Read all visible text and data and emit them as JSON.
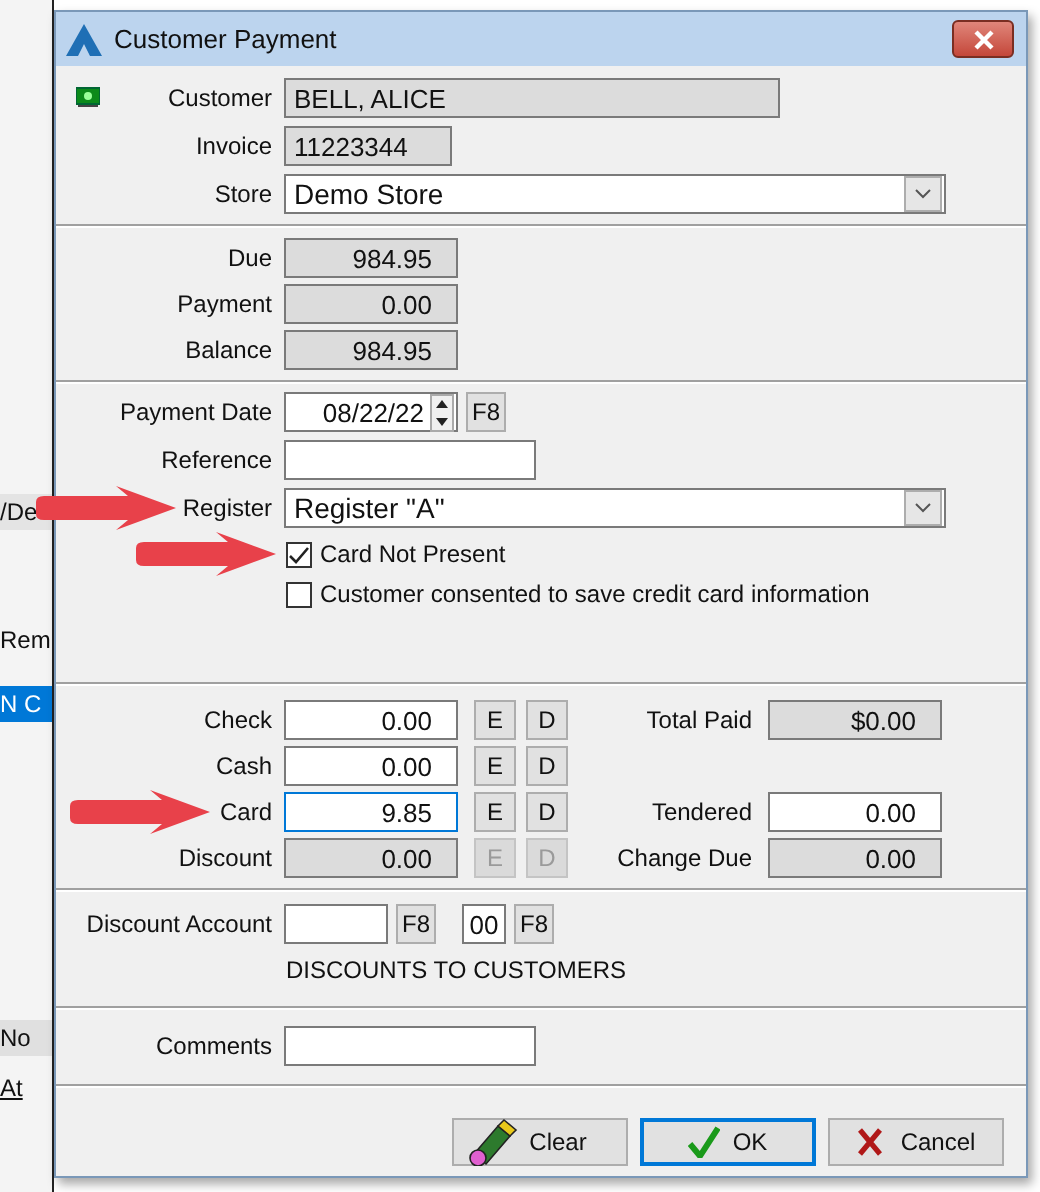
{
  "window": {
    "title": "Customer Payment"
  },
  "background_fragments": [
    {
      "text": "/De",
      "selected": false
    },
    {
      "text": "Rem",
      "selected": false
    },
    {
      "text": "N C",
      "selected": true
    },
    {
      "text": "No",
      "selected": false
    },
    {
      "text": "At",
      "selected": false
    }
  ],
  "customer": {
    "label": "Customer",
    "value": "BELL, ALICE"
  },
  "invoice": {
    "label": "Invoice",
    "value": "11223344"
  },
  "store": {
    "label": "Store",
    "value": "Demo Store"
  },
  "totals": [
    {
      "label": "Due",
      "value": "984.95"
    },
    {
      "label": "Payment",
      "value": "0.00"
    },
    {
      "label": "Balance",
      "value": "984.95"
    }
  ],
  "payment_date": {
    "label": "Payment Date",
    "value": "08/22/22",
    "button": "F8"
  },
  "reference": {
    "label": "Reference"
  },
  "register": {
    "label": "Register",
    "value": "Register \"A\"",
    "pointer": true
  },
  "options": [
    {
      "label": "Card Not Present",
      "checked": true,
      "pointer": true
    },
    {
      "label": "Customer consented to save credit card information",
      "checked": false,
      "pointer": false
    }
  ],
  "tenders": [
    {
      "label": "Check",
      "value": "0.00",
      "disabled": false,
      "focused": false,
      "pointer": false,
      "buttons": [
        "E",
        "D"
      ],
      "side": {
        "label": "Total Paid",
        "value": "$0.00",
        "editable": false
      }
    },
    {
      "label": "Cash",
      "value": "0.00",
      "disabled": false,
      "focused": false,
      "pointer": false,
      "buttons": [
        "E",
        "D"
      ]
    },
    {
      "label": "Card",
      "value": "9.85",
      "disabled": false,
      "focused": true,
      "pointer": true,
      "buttons": [
        "E",
        "D"
      ],
      "side": {
        "label": "Tendered",
        "value": "0.00",
        "editable": true
      }
    },
    {
      "label": "Discount",
      "value": "0.00",
      "disabled": true,
      "focused": false,
      "pointer": false,
      "buttons": [
        "E",
        "D"
      ],
      "side": {
        "label": "Change Due",
        "value": "0.00",
        "editable": false
      }
    }
  ],
  "discount_account": {
    "label": "Discount Account",
    "buttons": [
      "F8",
      "F8"
    ],
    "code": "00",
    "description": "DISCOUNTS TO CUSTOMERS"
  },
  "comments": {
    "label": "Comments"
  },
  "buttons": [
    {
      "kind": "clear",
      "label": "Clear",
      "default": false
    },
    {
      "kind": "ok",
      "label": "OK",
      "default": true
    },
    {
      "kind": "cancel",
      "label": "Cancel",
      "default": false
    }
  ]
}
